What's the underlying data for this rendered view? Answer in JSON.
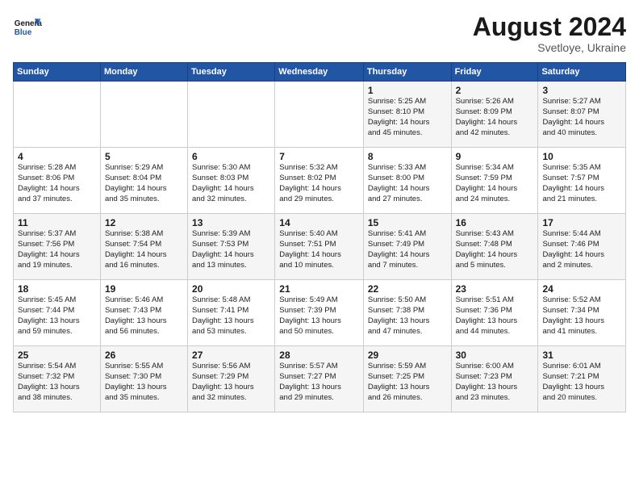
{
  "header": {
    "logo_general": "General",
    "logo_blue": "Blue",
    "month_title": "August 2024",
    "location": "Svetloye, Ukraine"
  },
  "days_of_week": [
    "Sunday",
    "Monday",
    "Tuesday",
    "Wednesday",
    "Thursday",
    "Friday",
    "Saturday"
  ],
  "weeks": [
    [
      {
        "day": "",
        "info": ""
      },
      {
        "day": "",
        "info": ""
      },
      {
        "day": "",
        "info": ""
      },
      {
        "day": "",
        "info": ""
      },
      {
        "day": "1",
        "info": "Sunrise: 5:25 AM\nSunset: 8:10 PM\nDaylight: 14 hours\nand 45 minutes."
      },
      {
        "day": "2",
        "info": "Sunrise: 5:26 AM\nSunset: 8:09 PM\nDaylight: 14 hours\nand 42 minutes."
      },
      {
        "day": "3",
        "info": "Sunrise: 5:27 AM\nSunset: 8:07 PM\nDaylight: 14 hours\nand 40 minutes."
      }
    ],
    [
      {
        "day": "4",
        "info": "Sunrise: 5:28 AM\nSunset: 8:06 PM\nDaylight: 14 hours\nand 37 minutes."
      },
      {
        "day": "5",
        "info": "Sunrise: 5:29 AM\nSunset: 8:04 PM\nDaylight: 14 hours\nand 35 minutes."
      },
      {
        "day": "6",
        "info": "Sunrise: 5:30 AM\nSunset: 8:03 PM\nDaylight: 14 hours\nand 32 minutes."
      },
      {
        "day": "7",
        "info": "Sunrise: 5:32 AM\nSunset: 8:02 PM\nDaylight: 14 hours\nand 29 minutes."
      },
      {
        "day": "8",
        "info": "Sunrise: 5:33 AM\nSunset: 8:00 PM\nDaylight: 14 hours\nand 27 minutes."
      },
      {
        "day": "9",
        "info": "Sunrise: 5:34 AM\nSunset: 7:59 PM\nDaylight: 14 hours\nand 24 minutes."
      },
      {
        "day": "10",
        "info": "Sunrise: 5:35 AM\nSunset: 7:57 PM\nDaylight: 14 hours\nand 21 minutes."
      }
    ],
    [
      {
        "day": "11",
        "info": "Sunrise: 5:37 AM\nSunset: 7:56 PM\nDaylight: 14 hours\nand 19 minutes."
      },
      {
        "day": "12",
        "info": "Sunrise: 5:38 AM\nSunset: 7:54 PM\nDaylight: 14 hours\nand 16 minutes."
      },
      {
        "day": "13",
        "info": "Sunrise: 5:39 AM\nSunset: 7:53 PM\nDaylight: 14 hours\nand 13 minutes."
      },
      {
        "day": "14",
        "info": "Sunrise: 5:40 AM\nSunset: 7:51 PM\nDaylight: 14 hours\nand 10 minutes."
      },
      {
        "day": "15",
        "info": "Sunrise: 5:41 AM\nSunset: 7:49 PM\nDaylight: 14 hours\nand 7 minutes."
      },
      {
        "day": "16",
        "info": "Sunrise: 5:43 AM\nSunset: 7:48 PM\nDaylight: 14 hours\nand 5 minutes."
      },
      {
        "day": "17",
        "info": "Sunrise: 5:44 AM\nSunset: 7:46 PM\nDaylight: 14 hours\nand 2 minutes."
      }
    ],
    [
      {
        "day": "18",
        "info": "Sunrise: 5:45 AM\nSunset: 7:44 PM\nDaylight: 13 hours\nand 59 minutes."
      },
      {
        "day": "19",
        "info": "Sunrise: 5:46 AM\nSunset: 7:43 PM\nDaylight: 13 hours\nand 56 minutes."
      },
      {
        "day": "20",
        "info": "Sunrise: 5:48 AM\nSunset: 7:41 PM\nDaylight: 13 hours\nand 53 minutes."
      },
      {
        "day": "21",
        "info": "Sunrise: 5:49 AM\nSunset: 7:39 PM\nDaylight: 13 hours\nand 50 minutes."
      },
      {
        "day": "22",
        "info": "Sunrise: 5:50 AM\nSunset: 7:38 PM\nDaylight: 13 hours\nand 47 minutes."
      },
      {
        "day": "23",
        "info": "Sunrise: 5:51 AM\nSunset: 7:36 PM\nDaylight: 13 hours\nand 44 minutes."
      },
      {
        "day": "24",
        "info": "Sunrise: 5:52 AM\nSunset: 7:34 PM\nDaylight: 13 hours\nand 41 minutes."
      }
    ],
    [
      {
        "day": "25",
        "info": "Sunrise: 5:54 AM\nSunset: 7:32 PM\nDaylight: 13 hours\nand 38 minutes."
      },
      {
        "day": "26",
        "info": "Sunrise: 5:55 AM\nSunset: 7:30 PM\nDaylight: 13 hours\nand 35 minutes."
      },
      {
        "day": "27",
        "info": "Sunrise: 5:56 AM\nSunset: 7:29 PM\nDaylight: 13 hours\nand 32 minutes."
      },
      {
        "day": "28",
        "info": "Sunrise: 5:57 AM\nSunset: 7:27 PM\nDaylight: 13 hours\nand 29 minutes."
      },
      {
        "day": "29",
        "info": "Sunrise: 5:59 AM\nSunset: 7:25 PM\nDaylight: 13 hours\nand 26 minutes."
      },
      {
        "day": "30",
        "info": "Sunrise: 6:00 AM\nSunset: 7:23 PM\nDaylight: 13 hours\nand 23 minutes."
      },
      {
        "day": "31",
        "info": "Sunrise: 6:01 AM\nSunset: 7:21 PM\nDaylight: 13 hours\nand 20 minutes."
      }
    ]
  ]
}
